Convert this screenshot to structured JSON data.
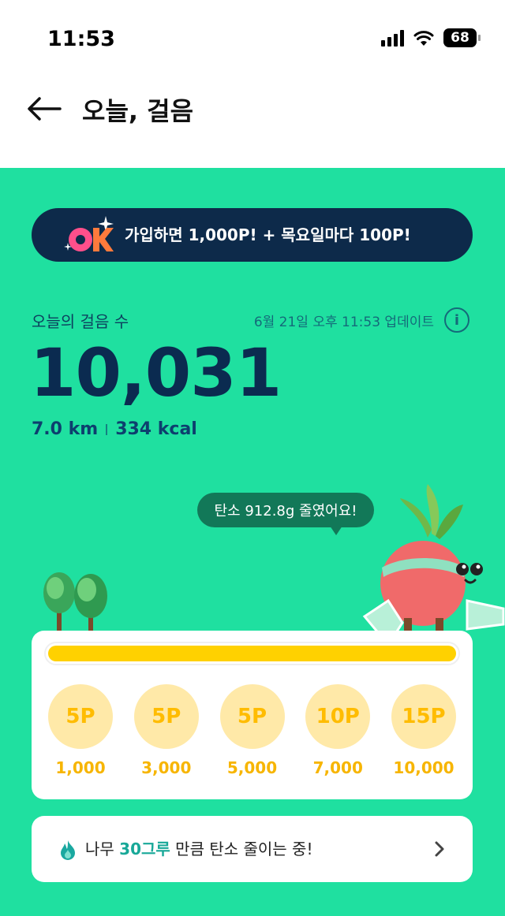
{
  "status_bar": {
    "time": "11:53",
    "battery": "68",
    "icons": [
      "signal-icon",
      "wifi-icon",
      "battery-icon"
    ]
  },
  "header": {
    "title": "오늘, 걸음",
    "back_icon": "arrow-left-icon"
  },
  "banner": {
    "badge_icon": "ok-badge-icon",
    "text": "가입하면 1,000P! + 목요일마다 100P!"
  },
  "steps": {
    "label": "오늘의 걸음 수",
    "updated": "6월 21일 오후 11:53 업데이트",
    "info_icon": "info-icon",
    "count": "10,031",
    "distance": "7.0 km",
    "calories": "334 kcal"
  },
  "speech_bubble": {
    "text": "탄소 912.8g 줄였어요!"
  },
  "progress": {
    "fraction": 1.0,
    "milestones": [
      {
        "points": "5P",
        "steps": "1,000"
      },
      {
        "points": "5P",
        "steps": "3,000"
      },
      {
        "points": "5P",
        "steps": "5,000"
      },
      {
        "points": "10P",
        "steps": "7,000"
      },
      {
        "points": "15P",
        "steps": "10,000"
      }
    ]
  },
  "tree_card": {
    "prefix": "나무 ",
    "highlight": "30그루",
    "suffix": " 만큼 탄소 줄이는 중!",
    "icon": "flame-icon",
    "chevron_icon": "chevron-right-icon"
  },
  "colors": {
    "background": "#1fe0a0",
    "navy": "#0b2b50",
    "progress": "#ffd100",
    "milestone_bg": "#ffe9a8",
    "milestone_text": "#f7b500",
    "highlight": "#18a898",
    "bubble": "#127858"
  }
}
